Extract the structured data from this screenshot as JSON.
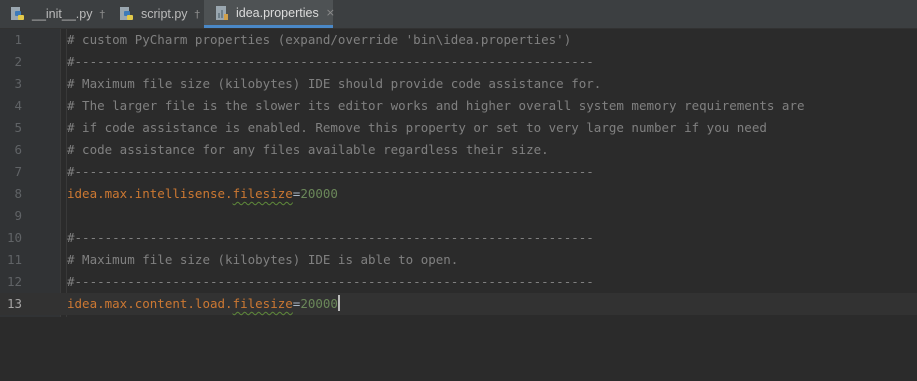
{
  "tabs": [
    {
      "label": "__init__.py",
      "icon": "python-file-icon",
      "pinned": true,
      "active": false
    },
    {
      "label": "script.py",
      "icon": "python-file-icon",
      "pinned": true,
      "active": false
    },
    {
      "label": "idea.properties",
      "icon": "properties-file-icon",
      "pinned": false,
      "active": true
    }
  ],
  "tab_controls": {
    "pin_glyph": "†",
    "close_glyph": "×"
  },
  "editor": {
    "current_line": 13,
    "lines": [
      {
        "num": "1",
        "comment": "# custom PyCharm properties (expand/override 'bin\\idea.properties')"
      },
      {
        "num": "2",
        "comment": "#---------------------------------------------------------------------"
      },
      {
        "num": "3",
        "comment": "# Maximum file size (kilobytes) IDE should provide code assistance for."
      },
      {
        "num": "4",
        "comment": "# The larger file is the slower its editor works and higher overall system memory requirements are"
      },
      {
        "num": "5",
        "comment": "# if code assistance is enabled. Remove this property or set to very large number if you need"
      },
      {
        "num": "6",
        "comment": "# code assistance for any files available regardless their size."
      },
      {
        "num": "7",
        "comment": "#---------------------------------------------------------------------"
      },
      {
        "num": "8",
        "key_prefix": "idea.max.intellisense.",
        "key_word": "filesize",
        "eq": "=",
        "value": "20000"
      },
      {
        "num": "9"
      },
      {
        "num": "10",
        "comment": "#---------------------------------------------------------------------"
      },
      {
        "num": "11",
        "comment": "# Maximum file size (kilobytes) IDE is able to open."
      },
      {
        "num": "12",
        "comment": "#---------------------------------------------------------------------"
      },
      {
        "num": "13",
        "key_prefix": "idea.max.content.load.",
        "key_word": "filesize",
        "eq": "=",
        "value": "20000"
      }
    ]
  },
  "colors": {
    "background": "#2b2b2b",
    "gutter": "#313335",
    "comment": "#808080",
    "property_key": "#cc7832",
    "property_value": "#6a8759",
    "active_tab_underline": "#4a88c7"
  }
}
